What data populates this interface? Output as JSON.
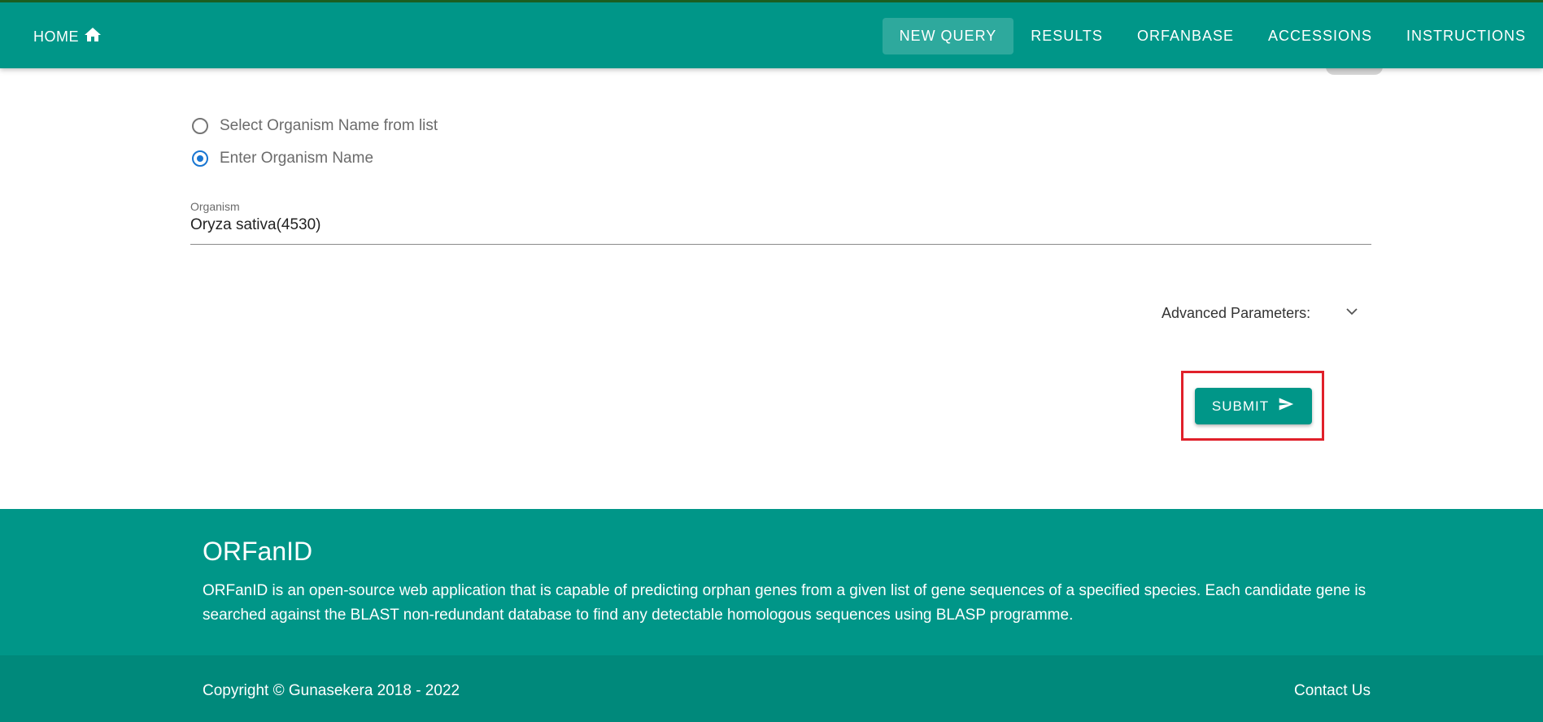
{
  "header": {
    "home_label": "HOME",
    "home_icon": "home-icon",
    "nav": [
      {
        "label": "NEW QUERY",
        "active": true
      },
      {
        "label": "RESULTS",
        "active": false
      },
      {
        "label": "ORFANBASE",
        "active": false
      },
      {
        "label": "ACCESSIONS",
        "active": false
      },
      {
        "label": "INSTRUCTIONS",
        "active": false
      }
    ]
  },
  "form": {
    "organism_options": [
      {
        "label": "Select Organism Name from list",
        "selected": false
      },
      {
        "label": "Enter Organism Name",
        "selected": true
      }
    ],
    "organism_field": {
      "label": "Organism",
      "value": "Oryza sativa(4530)"
    },
    "advanced_label": "Advanced Parameters:",
    "advanced_icon": "chevron-down-icon",
    "submit_label": "SUBMIT",
    "submit_icon": "send-icon"
  },
  "footer": {
    "title": "ORFanID",
    "description": "ORFanID is an open-source web application that is capable of predicting orphan genes from a given list of gene sequences of a specified species. Each candidate gene is searched against the BLAST non-redundant database to find any detectable homologous sequences using BLASP programme.",
    "copyright": "Copyright  © Gunasekera 2018 - 2022",
    "contact_label": "Contact Us"
  },
  "colors": {
    "primary": "#009688",
    "footer_bottom": "#00897b",
    "radio_selected": "#1976d2",
    "highlight_box": "#e0202a"
  }
}
